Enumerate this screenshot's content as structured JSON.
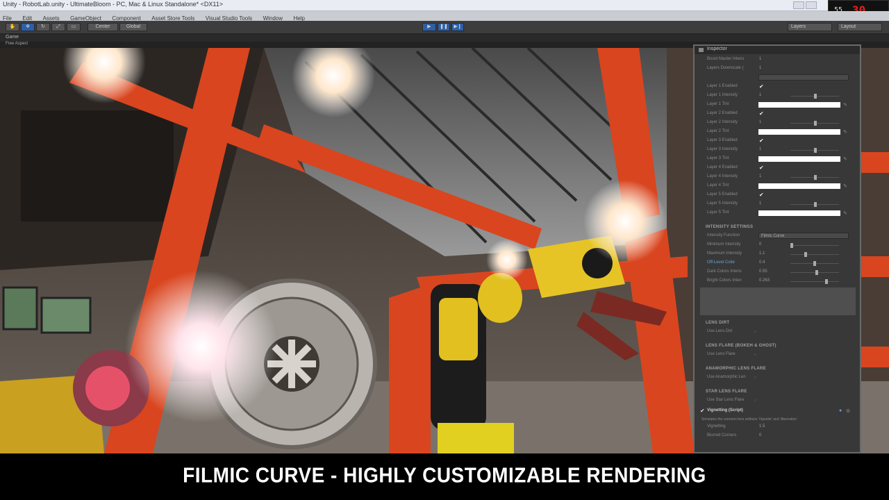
{
  "titlebar": {
    "title": "Unity - RobotLab.unity - UltimateBloom - PC, Mac & Linux Standalone* <DX11>"
  },
  "recorder": {
    "fps": "55",
    "rec": "30"
  },
  "menubar": {
    "items": [
      "File",
      "Edit",
      "Assets",
      "GameObject",
      "Component",
      "Asset Store Tools",
      "Visual Studio Tools",
      "Window",
      "Help"
    ]
  },
  "toolbar": {
    "pivot_label": "Center",
    "space_label": "Global",
    "layers_label": "Layers",
    "layout_label": "Layout"
  },
  "game_tab": {
    "label": "Game",
    "aspect": "Free Aspect"
  },
  "inspector": {
    "title": "Inspector",
    "top_rows": [
      {
        "label": "Boost Master Intens",
        "value": "1"
      },
      {
        "label": "Layers Downscale (",
        "value": "1"
      }
    ],
    "layer_rows": [
      {
        "label": "Layer 1 Enabled",
        "type": "check"
      },
      {
        "label": "Layer 1 Intensity",
        "type": "value",
        "value": "1"
      },
      {
        "label": "Layer 1 Tint",
        "type": "color"
      },
      {
        "label": "Layer 2 Enabled",
        "type": "check"
      },
      {
        "label": "Layer 2 Intensity",
        "type": "value",
        "value": "1"
      },
      {
        "label": "Layer 2 Tint",
        "type": "color"
      },
      {
        "label": "Layer 3 Enabled",
        "type": "check"
      },
      {
        "label": "Layer 3 Intensity",
        "type": "value",
        "value": "1"
      },
      {
        "label": "Layer 3 Tint",
        "type": "color"
      },
      {
        "label": "Layer 4 Enabled",
        "type": "check"
      },
      {
        "label": "Layer 4 Intensity",
        "type": "value",
        "value": "1"
      },
      {
        "label": "Layer 4 Tint",
        "type": "color"
      },
      {
        "label": "Layer 5 Enabled",
        "type": "check"
      },
      {
        "label": "Layer 5 Intensity",
        "type": "value",
        "value": "1"
      },
      {
        "label": "Layer 5 Tint",
        "type": "color"
      }
    ],
    "intensity_settings": {
      "header": "INTENSITY SETTINGS",
      "function_label": "Intensity Function",
      "function_value": "Filmic Curve",
      "rows": [
        {
          "label": "Minimum Intensity",
          "value": "0",
          "slider": 0.0
        },
        {
          "label": "Maximum Intensity",
          "value": "1.1",
          "slider": 0.3
        },
        {
          "label": "Off-Level Color",
          "value": "0.4",
          "slider": 0.5,
          "highlight": true
        },
        {
          "label": "Dark Colors Intens",
          "value": "0.55",
          "slider": 0.55
        },
        {
          "label": "Bright Colors Inten",
          "value": "0.263",
          "slider": 0.75
        }
      ]
    },
    "lens_dirt": {
      "header": "LENS DIRT",
      "row": "Use Lens Dirt"
    },
    "lens_flare": {
      "header": "LENS FLARE (BOKEH & GHOST)",
      "row": "Use Lens Flare"
    },
    "anamorphic": {
      "header": "ANAMORPHIC LENS FLARE",
      "row": "Use Anamorphic Len"
    },
    "star": {
      "header": "STAR LENS FLARE",
      "row": "Use Star Lens Flare"
    },
    "vignetting": {
      "component": "Vignetting (Script)",
      "desc": "Simulates the common lens artifacts 'Vignette' and 'Aberration'",
      "rows": [
        {
          "label": "Vignetting",
          "value": "1.5"
        },
        {
          "label": "Blurred Corners",
          "value": "0"
        }
      ]
    }
  },
  "caption": "FILMIC CURVE - HIGHLY CUSTOMIZABLE RENDERING"
}
